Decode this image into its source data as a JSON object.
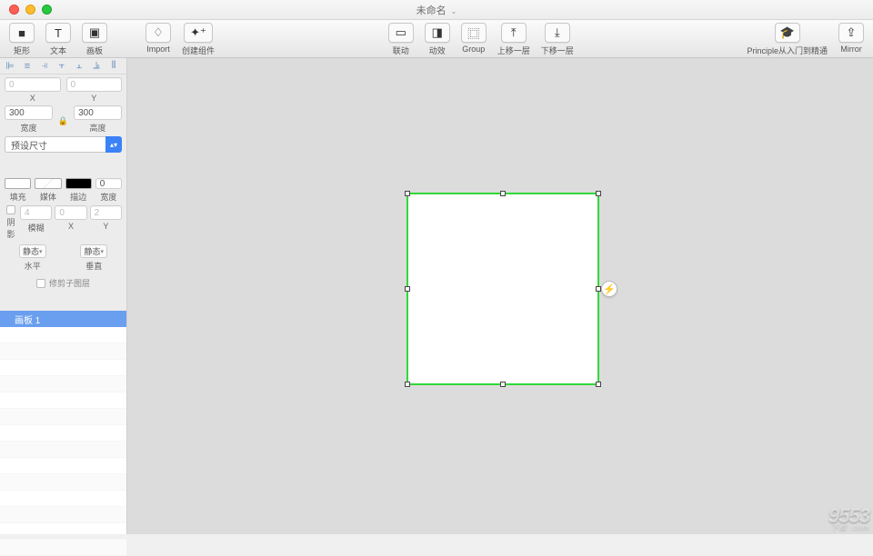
{
  "window": {
    "title": "未命名"
  },
  "toolbar": {
    "rect": "矩形",
    "text": "文本",
    "artboard": "画板",
    "import": "Import",
    "create_component": "创建组件",
    "link": "联动",
    "animate": "动效",
    "group": "Group",
    "move_up": "上移一层",
    "move_down": "下移一层",
    "tutorial": "Principle从入门到精通",
    "mirror": "Mirror"
  },
  "inspector": {
    "x_value": "0",
    "x_label": "X",
    "y_value": "0",
    "y_label": "Y",
    "w_value": "300",
    "w_label": "宽度",
    "h_value": "300",
    "h_label": "高度",
    "preset_label": "预设尺寸",
    "fill_label": "填充",
    "media_label": "媒体",
    "stroke_label": "描边",
    "stroke_width_value": "0",
    "stroke_width_label": "宽度",
    "shadow_label": "阴影",
    "blur_label": "模糊",
    "blur_value": "4",
    "offset_x_value": "0",
    "offset_x_label": "X",
    "offset_y_value": "2",
    "offset_y_label": "Y",
    "h_mode": "静态",
    "h_mode_label": "水平",
    "v_mode": "静态",
    "v_mode_label": "垂直",
    "clip_children_label": "修剪子图层"
  },
  "layers": {
    "selected": "画板 1"
  },
  "watermark": {
    "text": "9553",
    "sub": "下载 .com"
  }
}
